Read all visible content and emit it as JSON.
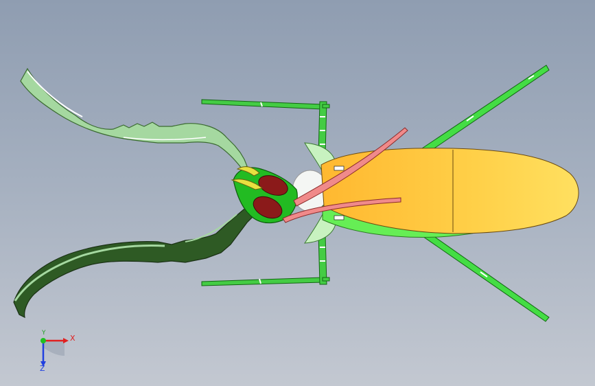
{
  "viewport": {
    "background_top": "#8f9db1",
    "background_bottom": "#c3c8d1"
  },
  "model": {
    "colors": {
      "wing": "#ffd54f",
      "abdomen": "#66ee55",
      "leg": "#33cc33",
      "foreleg_light": "#b6e6b0",
      "foreleg_dark": "#2e5a24",
      "head": "#22bb22",
      "eye": "#8b1a1a",
      "antenna": "#f08080",
      "thorax_plate": "#c8f2c0"
    }
  },
  "triad": {
    "x_label": "X",
    "y_label": "Y",
    "z_label": "Z",
    "x_color": "#e02020",
    "y_color": "#20c020",
    "z_color": "#2040e0"
  }
}
